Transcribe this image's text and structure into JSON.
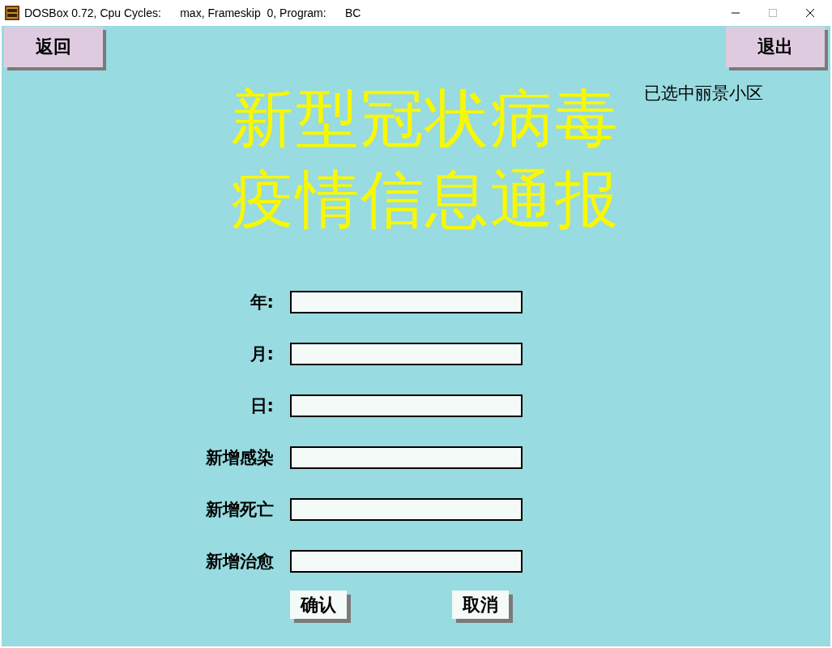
{
  "window": {
    "title": "DOSBox 0.72, Cpu Cycles:      max, Frameskip  0, Program:      BC"
  },
  "top_buttons": [
    "返回",
    "退出"
  ],
  "headline": [
    "新型冠状病毒",
    "疫情信息通报"
  ],
  "selection": "已选中丽景小区",
  "fields": [
    {
      "label": "年:"
    },
    {
      "label": "月:"
    },
    {
      "label": "日:"
    },
    {
      "label": "新增感染"
    },
    {
      "label": "新增死亡"
    },
    {
      "label": "新增治愈"
    }
  ],
  "actions": [
    "确认",
    "取消"
  ]
}
